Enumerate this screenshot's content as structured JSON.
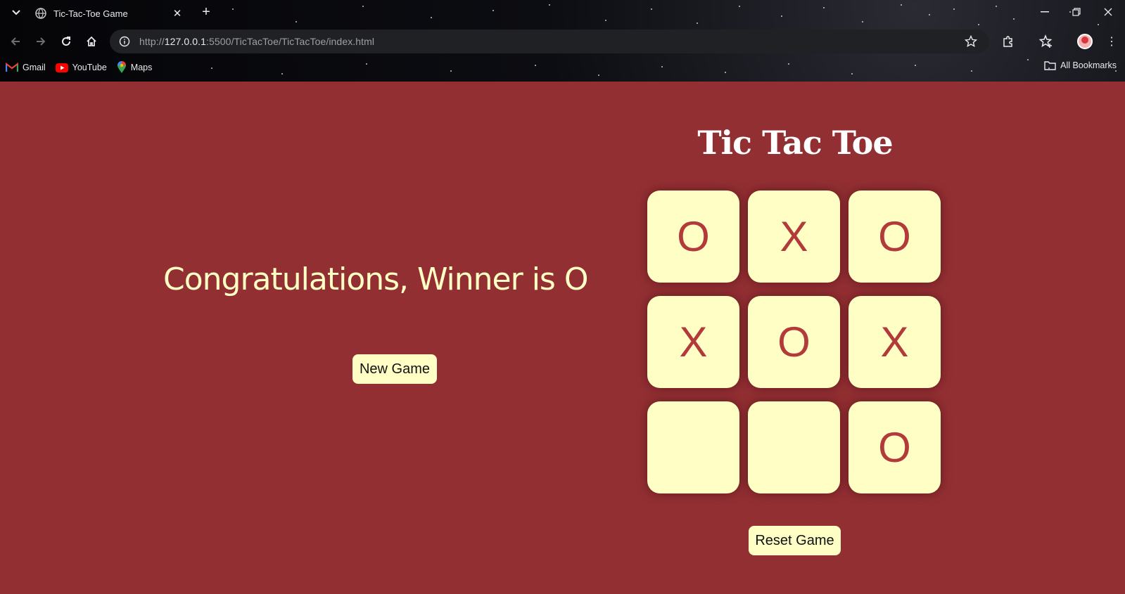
{
  "browser": {
    "tab_title": "Tic-Tac-Toe Game",
    "url_scheme": "http://",
    "url_host": "127.0.0.1",
    "url_rest": ":5500/TicTacToe/TicTacToe/index.html",
    "bookmarks": [
      {
        "label": "Gmail",
        "icon": "gmail-icon"
      },
      {
        "label": "YouTube",
        "icon": "youtube-icon"
      },
      {
        "label": "Maps",
        "icon": "maps-icon"
      }
    ],
    "all_bookmarks": "All Bookmarks"
  },
  "game": {
    "heading": "Tic Tac Toe",
    "message": "Congratulations, Winner is O",
    "new_game_label": "New Game",
    "reset_label": "Reset Game",
    "board": [
      "O",
      "X",
      "O",
      "X",
      "O",
      "X",
      "",
      "",
      "O"
    ]
  },
  "colors": {
    "page_background": "#922f33",
    "tile_background": "#ffffc5",
    "mark_color": "#b23a3a"
  }
}
